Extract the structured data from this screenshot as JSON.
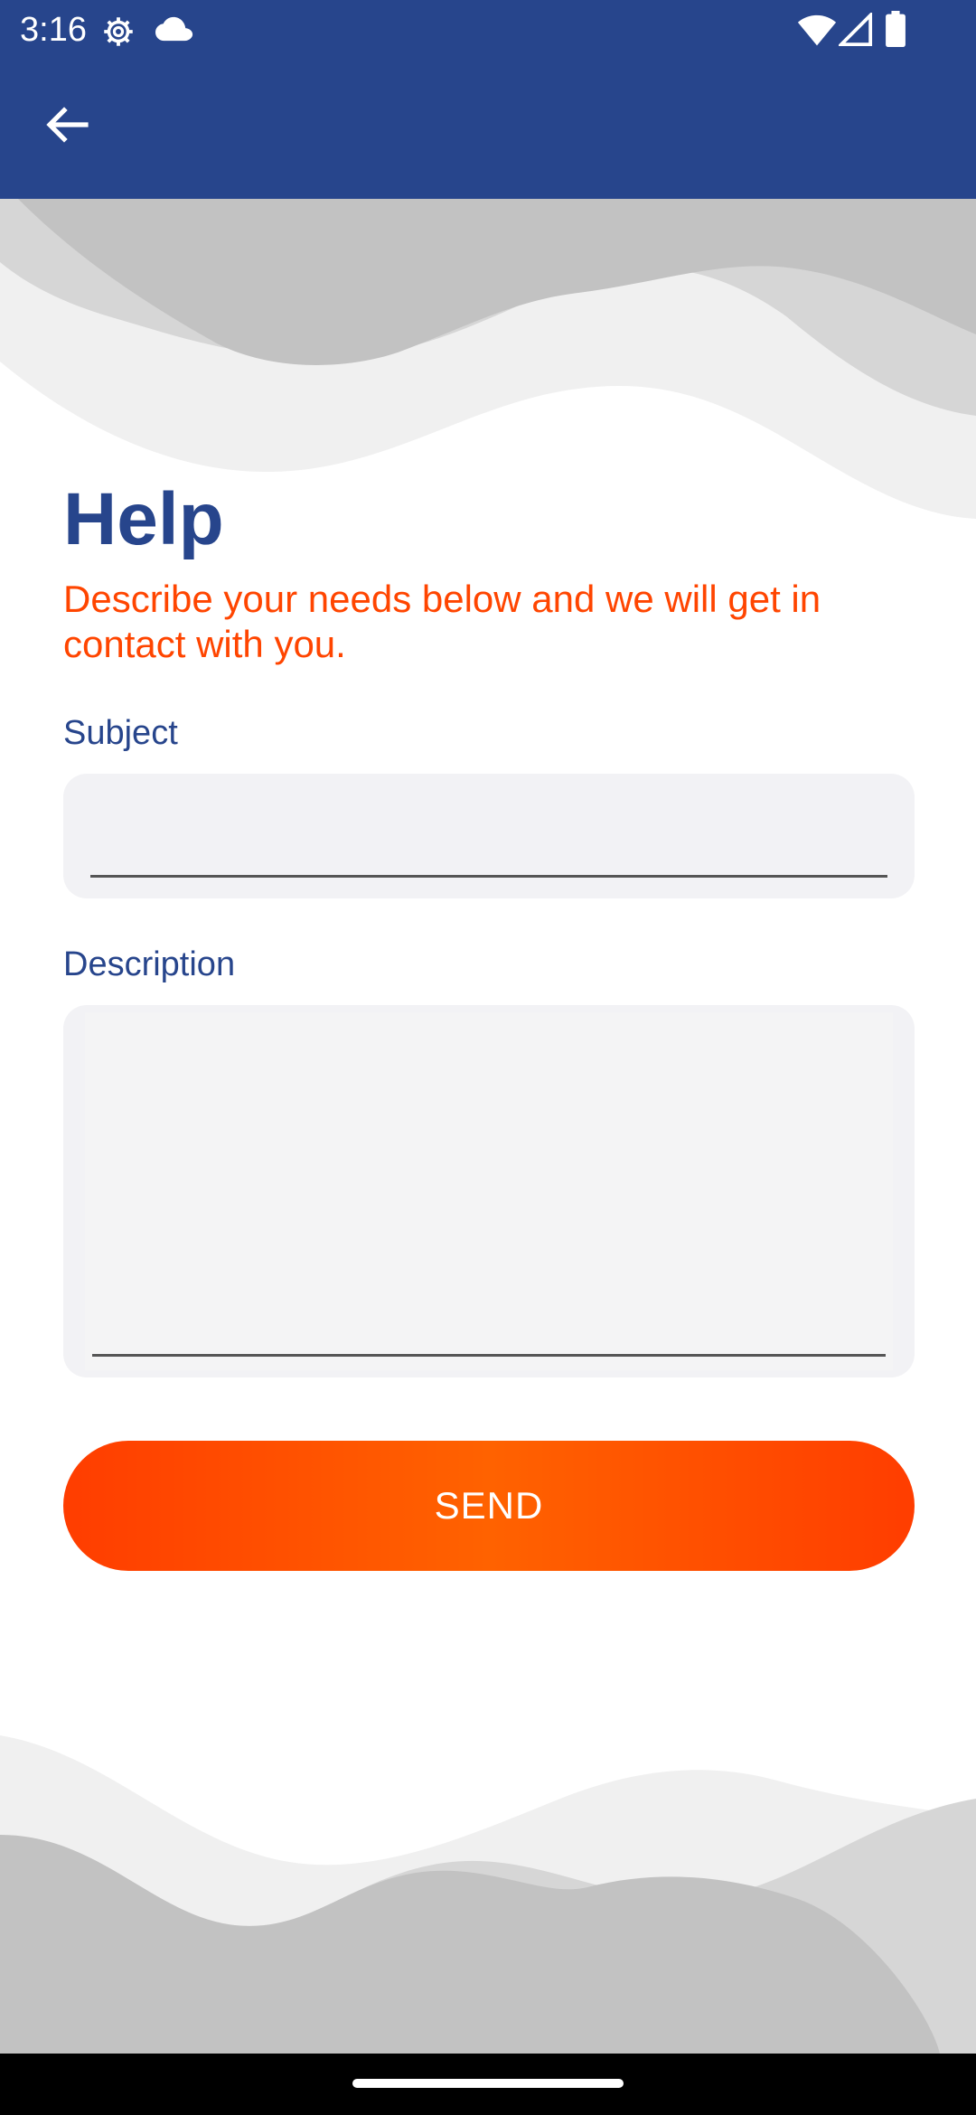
{
  "status_bar": {
    "time": "3:16",
    "icons": [
      "gear-icon",
      "cloud-icon",
      "wifi-icon",
      "signal-icon",
      "battery-icon"
    ]
  },
  "app_bar": {
    "back_icon": "arrow-left-icon",
    "background_color": "#27458c"
  },
  "page": {
    "title": "Help",
    "subtitle": "Describe your needs below and we will get in contact with you."
  },
  "form": {
    "subject_label": "Subject",
    "subject_value": "",
    "description_label": "Description",
    "description_value": "",
    "send_label": "SEND"
  },
  "colors": {
    "primary": "#27458c",
    "accent": "#ff4500",
    "input_bg": "#f2f2f5"
  }
}
